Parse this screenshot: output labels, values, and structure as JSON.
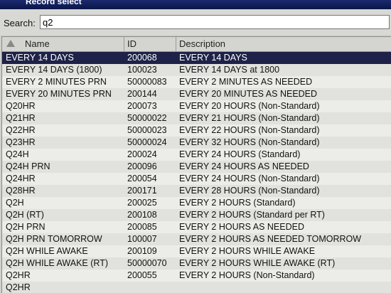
{
  "window": {
    "title": "Record select"
  },
  "search": {
    "label": "Search:",
    "value": "q2"
  },
  "table": {
    "columns": [
      "Name",
      "ID",
      "Description"
    ],
    "selected_index": 0,
    "rows": [
      {
        "name": "EVERY 14 DAYS",
        "id": "200068",
        "description": "EVERY 14 DAYS"
      },
      {
        "name": "EVERY 14 DAYS (1800)",
        "id": "100023",
        "description": "EVERY 14 DAYS at 1800"
      },
      {
        "name": "EVERY 2 MINUTES PRN",
        "id": "50000083",
        "description": "EVERY 2 MINUTES AS NEEDED"
      },
      {
        "name": "EVERY 20 MINUTES PRN",
        "id": "200144",
        "description": "EVERY 20 MINUTES AS NEEDED"
      },
      {
        "name": "Q20HR",
        "id": "200073",
        "description": "EVERY 20 HOURS (Non-Standard)"
      },
      {
        "name": "Q21HR",
        "id": "50000022",
        "description": "EVERY 21 HOURS (Non-Standard)"
      },
      {
        "name": "Q22HR",
        "id": "50000023",
        "description": "EVERY 22 HOURS (Non-Standard)"
      },
      {
        "name": "Q23HR",
        "id": "50000024",
        "description": "EVERY 32 HOURS (Non-Standard)"
      },
      {
        "name": "Q24H",
        "id": "200024",
        "description": "EVERY 24 HOURS (Standard)"
      },
      {
        "name": "Q24H PRN",
        "id": "200096",
        "description": "EVERY 24 HOURS AS NEEDED"
      },
      {
        "name": "Q24HR",
        "id": "200054",
        "description": "EVERY 24 HOURS (Non-Standard)"
      },
      {
        "name": "Q28HR",
        "id": "200171",
        "description": "EVERY 28 HOURS (Non-Standard)"
      },
      {
        "name": "Q2H",
        "id": "200025",
        "description": "EVERY 2 HOURS (Standard)"
      },
      {
        "name": "Q2H (RT)",
        "id": "200108",
        "description": "EVERY 2 HOURS (Standard per RT)"
      },
      {
        "name": "Q2H PRN",
        "id": "200085",
        "description": "EVERY 2 HOURS AS NEEDED"
      },
      {
        "name": "Q2H PRN TOMORROW",
        "id": "100007",
        "description": "EVERY 2 HOURS AS NEEDED TOMORROW"
      },
      {
        "name": "Q2H WHILE AWAKE",
        "id": "200109",
        "description": "EVERY 2 HOURS WHILE AWAKE"
      },
      {
        "name": "Q2H WHILE AWAKE (RT)",
        "id": "50000070",
        "description": "EVERY 2 HOURS WHILE AWAKE (RT)"
      },
      {
        "name": "Q2HR",
        "id": "200055",
        "description": "EVERY 2 HOURS (Non-Standard)"
      },
      {
        "name": "Q2HR",
        "id": "",
        "description": ""
      }
    ]
  }
}
